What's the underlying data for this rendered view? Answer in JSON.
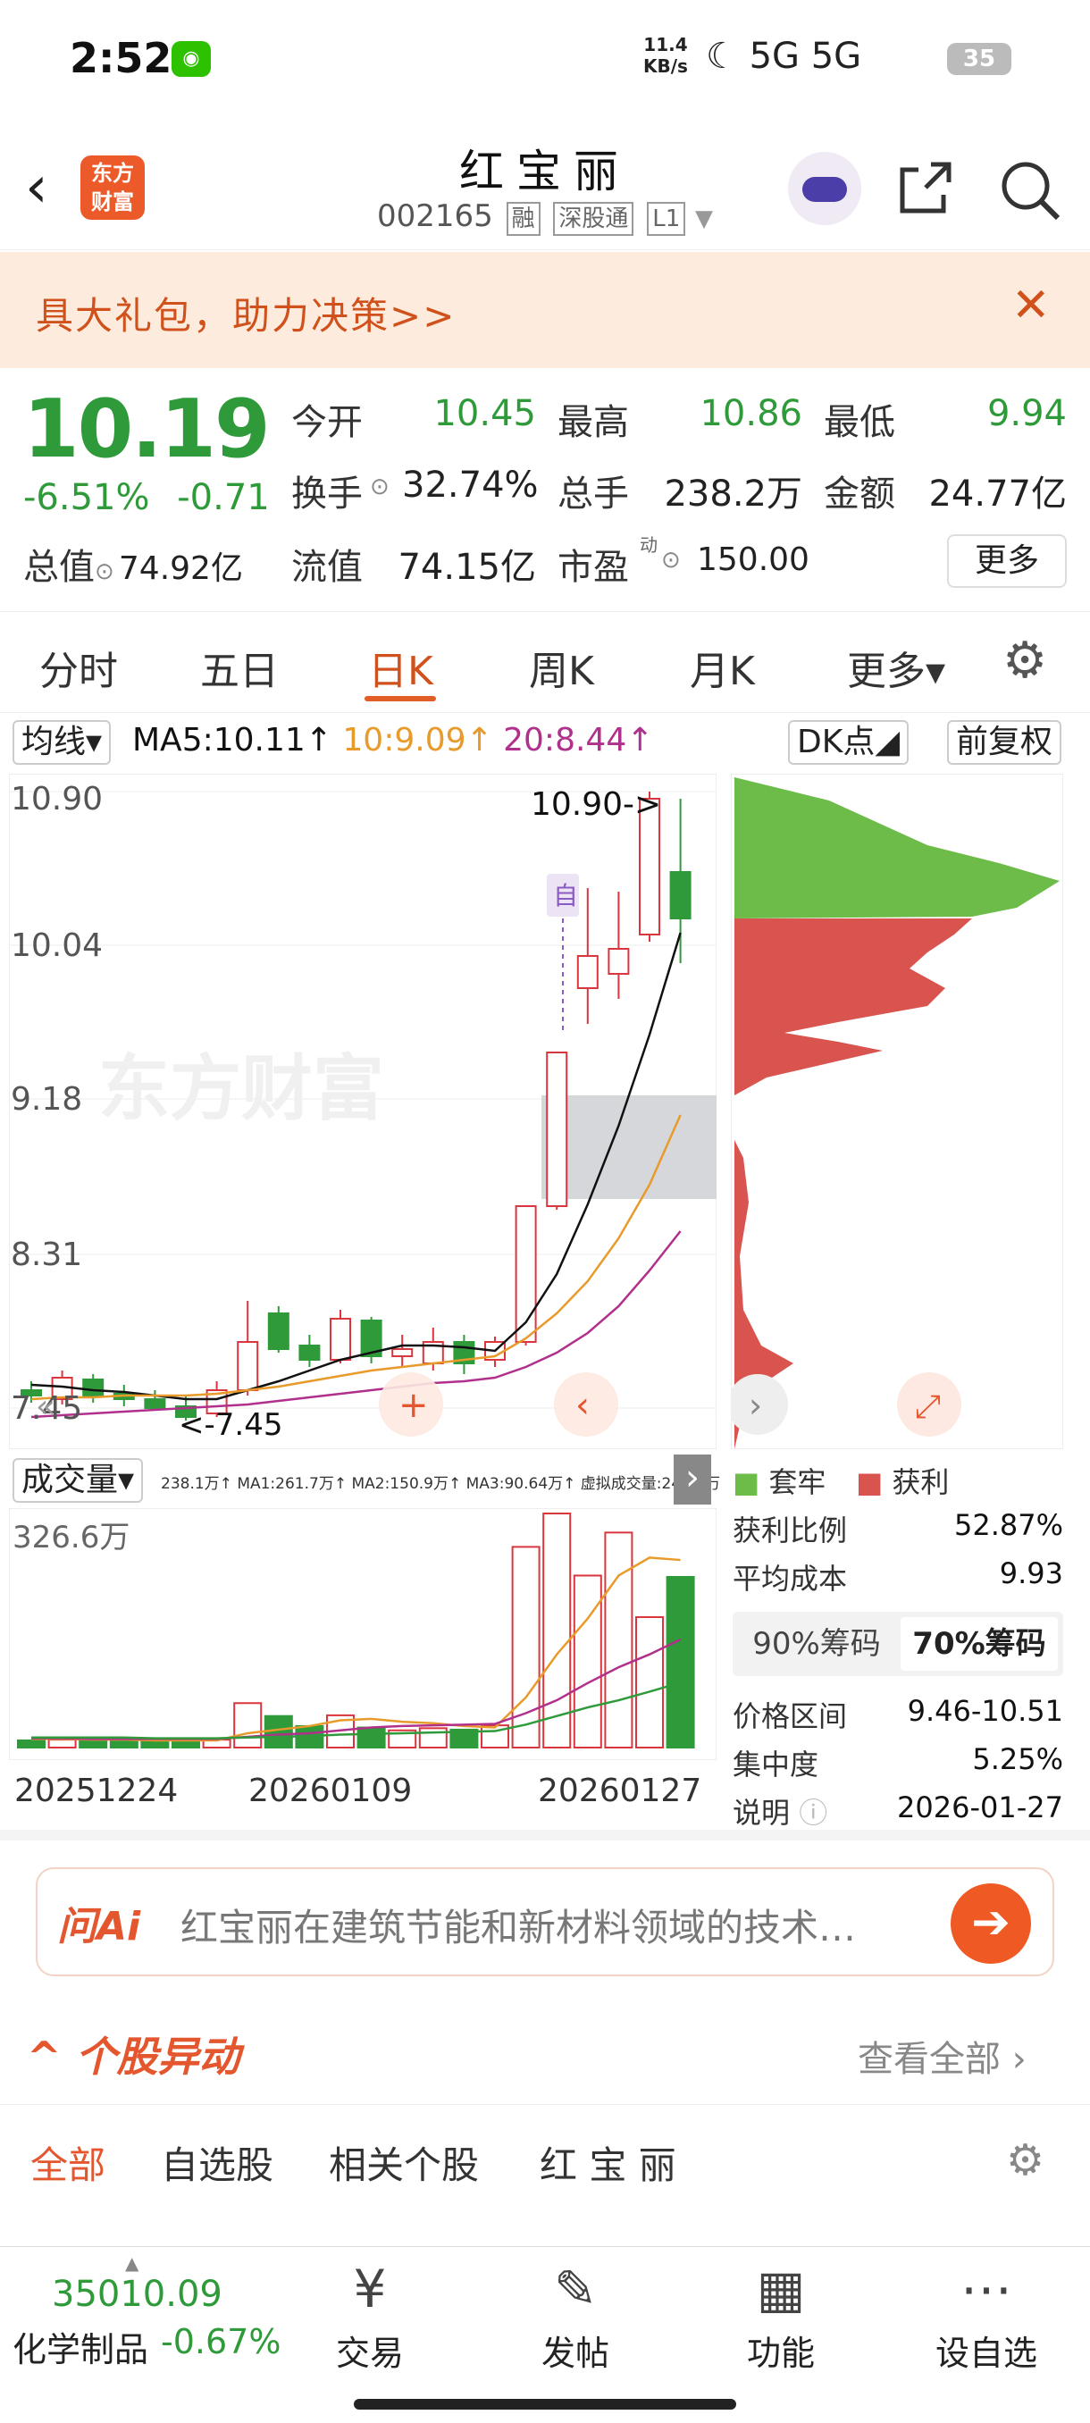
{
  "status": {
    "time": "2:52",
    "net_speed": "11.4",
    "net_unit": "KB/s",
    "signal": "☾ 5G 5G",
    "battery": "35"
  },
  "header": {
    "back": "‹",
    "logo": "东方\n财富",
    "title": "红宝丽",
    "code": "002165",
    "tags": [
      "融",
      "深股通",
      "L1"
    ]
  },
  "banner": {
    "text": "具大礼包，助力决策>>",
    "close": "✕"
  },
  "quote": {
    "price": "10.19",
    "change_pct": "-6.51%",
    "change": "-0.71",
    "open_label": "今开",
    "open": "10.45",
    "high_label": "最高",
    "high": "10.86",
    "low_label": "最低",
    "low": "9.94",
    "turnover_label": "换手",
    "turnover": "32.74%",
    "volume_label": "总手",
    "volume": "238.2万",
    "amount_label": "金额",
    "amount": "24.77亿",
    "mktcap_label": "总值",
    "mktcap": "74.92亿",
    "float_label": "流值",
    "float": "74.15亿",
    "pe_label": "市盈",
    "pe_sup": "动",
    "pe": "150.00",
    "more": "更多"
  },
  "tabs": [
    "分时",
    "五日",
    "日K",
    "周K",
    "月K",
    "更多▾"
  ],
  "chart": {
    "ma_select": "均线▾",
    "ma5": "MA5:10.11↑",
    "ma10": "10:9.09↑",
    "ma20": "20:8.44↑",
    "dk_button": "DK点◢",
    "adj_button": "前复权",
    "y_labels": [
      "10.90",
      "10.04",
      "9.18",
      "8.31",
      "7.45"
    ],
    "high_marker": "10.90->",
    "low_marker": "<-7.45",
    "self_tag": "自",
    "watermark": "东方财富",
    "vol_select": "成交量▾",
    "vol_legend": "238.1万↑ MA1:261.7万↑ MA2:150.9万↑ MA3:90.64万↑ 虚拟成交量:240.3万",
    "vol_max": "326.6万",
    "dates": [
      "20251224",
      "20260109",
      "20260127"
    ],
    "colors": {
      "up": "#d9363e",
      "down": "#2f9a3a",
      "ma5": "#111111",
      "ma10": "#e89a2a",
      "ma20": "#b0308c"
    }
  },
  "chart_data": {
    "type": "candlestick",
    "ylim": [
      7.45,
      10.9
    ],
    "candles": [
      {
        "o": 7.55,
        "c": 7.52,
        "h": 7.6,
        "l": 7.48
      },
      {
        "o": 7.5,
        "c": 7.62,
        "h": 7.66,
        "l": 7.47
      },
      {
        "o": 7.61,
        "c": 7.52,
        "h": 7.64,
        "l": 7.48
      },
      {
        "o": 7.53,
        "c": 7.5,
        "h": 7.58,
        "l": 7.46
      },
      {
        "o": 7.5,
        "c": 7.45,
        "h": 7.55,
        "l": 7.45
      },
      {
        "o": 7.46,
        "c": 7.4,
        "h": 7.52,
        "l": 7.38
      },
      {
        "o": 7.42,
        "c": 7.55,
        "h": 7.6,
        "l": 7.4
      },
      {
        "o": 7.55,
        "c": 7.82,
        "h": 8.05,
        "l": 7.52
      },
      {
        "o": 7.98,
        "c": 7.78,
        "h": 8.02,
        "l": 7.76
      },
      {
        "o": 7.8,
        "c": 7.72,
        "h": 7.86,
        "l": 7.68
      },
      {
        "o": 7.72,
        "c": 7.95,
        "h": 8.0,
        "l": 7.7
      },
      {
        "o": 7.94,
        "c": 7.74,
        "h": 7.96,
        "l": 7.7
      },
      {
        "o": 7.74,
        "c": 7.78,
        "h": 7.86,
        "l": 7.68
      },
      {
        "o": 7.7,
        "c": 7.82,
        "h": 7.9,
        "l": 7.66
      },
      {
        "o": 7.82,
        "c": 7.7,
        "h": 7.86,
        "l": 7.64
      },
      {
        "o": 7.72,
        "c": 7.82,
        "h": 7.85,
        "l": 7.68
      },
      {
        "o": 7.82,
        "c": 8.58,
        "h": 8.58,
        "l": 7.8
      },
      {
        "o": 8.58,
        "c": 9.44,
        "h": 9.44,
        "l": 8.56
      },
      {
        "o": 9.8,
        "c": 9.98,
        "h": 10.36,
        "l": 9.6
      },
      {
        "o": 9.88,
        "c": 10.02,
        "h": 10.34,
        "l": 9.74
      },
      {
        "o": 10.1,
        "c": 10.86,
        "h": 10.9,
        "l": 10.06
      },
      {
        "o": 10.45,
        "c": 10.19,
        "h": 10.86,
        "l": 9.94
      }
    ],
    "ma5": [
      7.58,
      7.57,
      7.55,
      7.54,
      7.52,
      7.5,
      7.5,
      7.55,
      7.6,
      7.66,
      7.72,
      7.76,
      7.8,
      7.8,
      7.79,
      7.77,
      7.93,
      8.2,
      8.59,
      9.03,
      9.54,
      10.11
    ],
    "ma10": [
      7.5,
      7.51,
      7.51,
      7.52,
      7.52,
      7.52,
      7.53,
      7.55,
      7.57,
      7.6,
      7.63,
      7.66,
      7.68,
      7.7,
      7.72,
      7.74,
      7.84,
      7.98,
      8.16,
      8.4,
      8.7,
      9.09
    ],
    "ma20": [
      7.4,
      7.41,
      7.42,
      7.43,
      7.44,
      7.45,
      7.46,
      7.47,
      7.49,
      7.51,
      7.53,
      7.55,
      7.57,
      7.59,
      7.6,
      7.62,
      7.68,
      7.76,
      7.87,
      8.02,
      8.22,
      8.44
    ],
    "volume": {
      "max": 326.6,
      "unit": "万",
      "values": [
        10,
        11,
        10,
        9,
        9,
        10,
        11,
        62,
        44,
        30,
        45,
        28,
        24,
        27,
        25,
        31,
        280,
        326.6,
        240,
        300,
        182,
        238.1
      ],
      "ma1": [
        12,
        12,
        11,
        11,
        10,
        10,
        10,
        20,
        25,
        30,
        38,
        40,
        36,
        34,
        30,
        28,
        70,
        130,
        180,
        240,
        265,
        261.7
      ],
      "ma2": [
        13,
        13,
        12,
        12,
        12,
        12,
        12,
        15,
        18,
        20,
        24,
        28,
        30,
        31,
        32,
        33,
        48,
        66,
        90,
        112,
        130,
        150.9
      ],
      "ma3": [
        14,
        14,
        14,
        14,
        13,
        13,
        13,
        14,
        15,
        16,
        18,
        19,
        20,
        21,
        22,
        23,
        32,
        44,
        56,
        66,
        78,
        90.64
      ]
    }
  },
  "chip": {
    "legend_loss": "套牢",
    "legend_profit": "获利",
    "profit_ratio_label": "获利比例",
    "profit_ratio": "52.87%",
    "avg_cost_label": "平均成本",
    "avg_cost": "9.93",
    "opt_90": "90%筹码",
    "opt_70": "70%筹码",
    "range_label": "价格区间",
    "range": "9.46-10.51",
    "concentration_label": "集中度",
    "concentration": "5.25%",
    "note_label": "说明",
    "note": "2026-01-27"
  },
  "askai": {
    "brand": "问Ai",
    "question": "红宝丽在建筑节能和新材料领域的技术…",
    "go": "➔"
  },
  "movers": {
    "title": "^ 个股异动",
    "view_all": "查看全部 ›"
  },
  "filters": [
    "全部",
    "自选股",
    "相关个股",
    "红 宝 丽"
  ],
  "bottom": {
    "index_value": "35010.09",
    "index_name": "化学制品",
    "index_change": "-0.67%",
    "nav": [
      {
        "icon": "¥",
        "label": "交易"
      },
      {
        "icon": "✎",
        "label": "发帖"
      },
      {
        "icon": "▦",
        "label": "功能"
      },
      {
        "icon": "⋯",
        "label": "设自选"
      }
    ]
  }
}
